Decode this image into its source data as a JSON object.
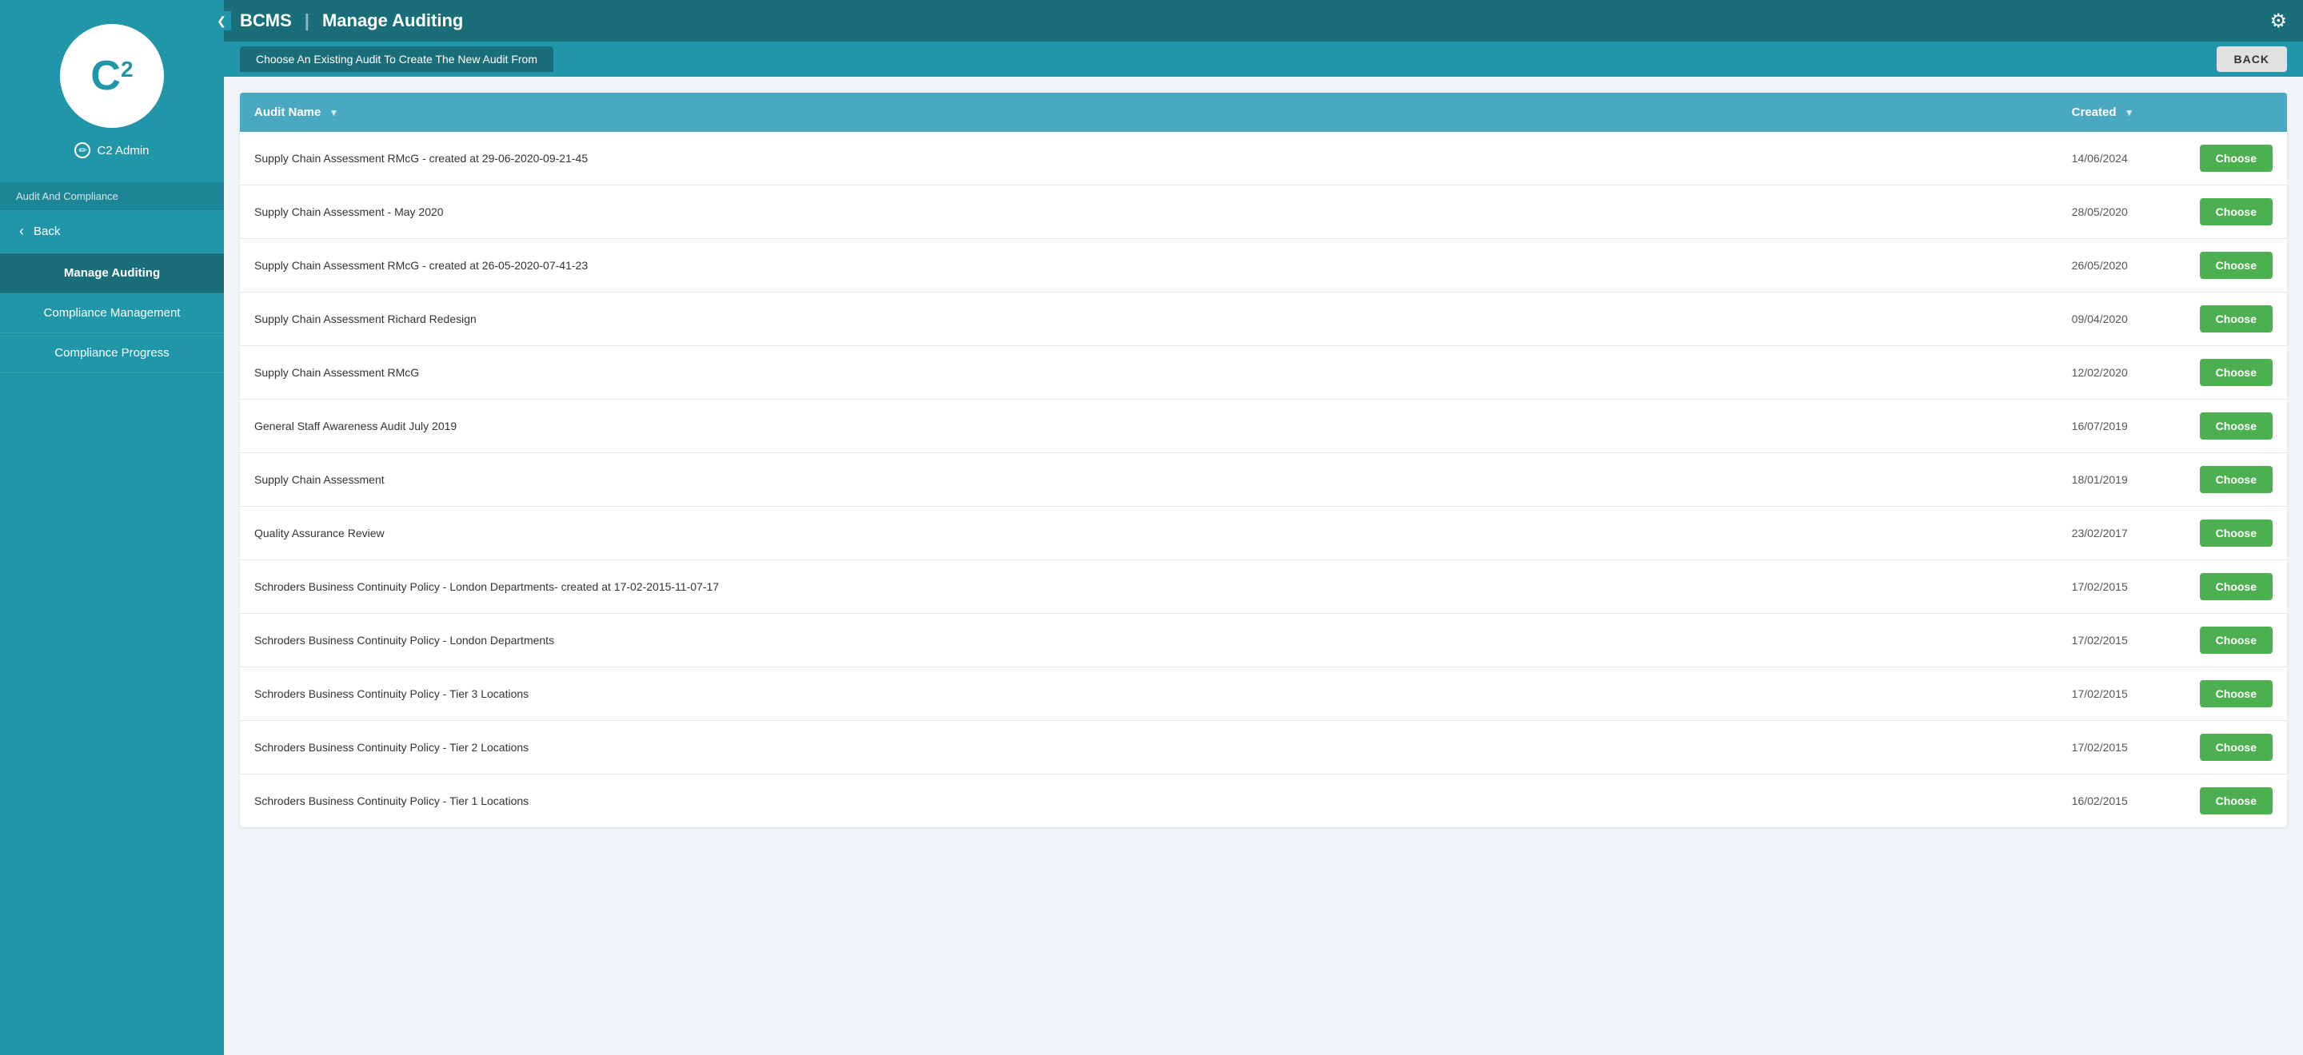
{
  "app": {
    "brand": "BCMS",
    "separator": "|",
    "page_title": "Manage Auditing",
    "gear_icon": "⚙"
  },
  "sub_header": {
    "tab_label": "Choose An Existing Audit To Create The New Audit From",
    "back_button_label": "BACK"
  },
  "sidebar": {
    "logo_c": "C",
    "logo_sup": "2",
    "user_label": "C2 Admin",
    "section_label": "Audit And Compliance",
    "back_label": "Back",
    "nav_items": [
      {
        "label": "Manage Auditing",
        "active": true
      },
      {
        "label": "Compliance Management",
        "active": false
      },
      {
        "label": "Compliance Progress",
        "active": false
      }
    ]
  },
  "table": {
    "col_audit_name": "Audit Name",
    "col_created": "Created",
    "col_action": "",
    "choose_label": "Choose",
    "rows": [
      {
        "name": "Supply Chain Assessment RMcG - created at 29-06-2020-09-21-45",
        "created": "14/06/2024"
      },
      {
        "name": "Supply Chain Assessment - May 2020",
        "created": "28/05/2020"
      },
      {
        "name": "Supply Chain Assessment RMcG - created at 26-05-2020-07-41-23",
        "created": "26/05/2020"
      },
      {
        "name": "Supply Chain Assessment Richard Redesign",
        "created": "09/04/2020"
      },
      {
        "name": "Supply Chain Assessment RMcG",
        "created": "12/02/2020"
      },
      {
        "name": "General Staff Awareness Audit July 2019",
        "created": "16/07/2019"
      },
      {
        "name": "Supply Chain Assessment",
        "created": "18/01/2019"
      },
      {
        "name": "Quality Assurance Review",
        "created": "23/02/2017"
      },
      {
        "name": "Schroders Business Continuity Policy - London Departments- created at 17-02-2015-11-07-17",
        "created": "17/02/2015"
      },
      {
        "name": "Schroders Business Continuity Policy - London Departments",
        "created": "17/02/2015"
      },
      {
        "name": "Schroders Business Continuity Policy - Tier 3 Locations",
        "created": "17/02/2015"
      },
      {
        "name": "Schroders Business Continuity Policy - Tier 2 Locations",
        "created": "17/02/2015"
      },
      {
        "name": "Schroders Business Continuity Policy - Tier 1 Locations",
        "created": "16/02/2015"
      }
    ]
  }
}
